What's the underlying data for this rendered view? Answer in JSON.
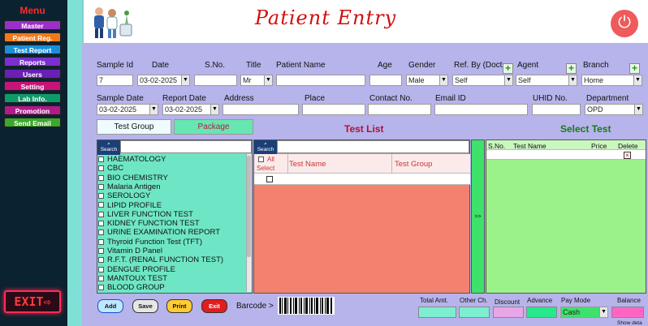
{
  "menu": {
    "title": "Menu",
    "items": [
      {
        "label": "Master",
        "color": "#9b30c8"
      },
      {
        "label": "Patient Reg.",
        "color": "#f07a1a"
      },
      {
        "label": "Test Report",
        "color": "#1a8fd8"
      },
      {
        "label": "Reports",
        "color": "#7a2fd0"
      },
      {
        "label": "Users",
        "color": "#6a1fb5"
      },
      {
        "label": "Setting",
        "color": "#c8147a"
      },
      {
        "label": "Lab Info.",
        "color": "#0f9a6a"
      },
      {
        "label": "Promotion",
        "color": "#b01a8a"
      },
      {
        "label": "Send Email",
        "color": "#3aa82a"
      }
    ],
    "exit_label": "EXIT⇨"
  },
  "header": {
    "title": "Patient Entry"
  },
  "form": {
    "row1_labels": {
      "sample_id": "Sample Id",
      "date": "Date",
      "sno": "S.No.",
      "title": "Title",
      "patient_name": "Patient Name",
      "age": "Age",
      "gender": "Gender",
      "ref_by": "Ref. By (Doct",
      "agent": "Agent",
      "branch": "Branch"
    },
    "row1_values": {
      "sample_id": "7",
      "date": "03-02-2025",
      "sno": "",
      "title": "Mr",
      "patient_name": "",
      "age": "",
      "gender": "Male",
      "ref_by": "Self",
      "agent": "Self",
      "branch": "Home"
    },
    "row2_labels": {
      "sample_date": "Sample Date",
      "report_date": "Report Date",
      "address": "Address",
      "place": "Place",
      "contact": "Contact No.",
      "email": "Email ID",
      "uhid": "UHID No.",
      "department": "Department"
    },
    "row2_values": {
      "sample_date": "03-02-2025",
      "report_date": "03-02-2025",
      "address": "",
      "place": "",
      "contact": "",
      "email": "",
      "uhid": "",
      "department": "OPD"
    }
  },
  "tabs": {
    "test_group": "Test Group",
    "package": "Package"
  },
  "test_list": {
    "title": "Test List",
    "search_label": "Search",
    "col_all": "All",
    "col_select": "Select",
    "col_test_name": "Test Name",
    "col_test_group": "Test Group",
    "arrow": ">>"
  },
  "group_list": {
    "search_label": "Search",
    "items": [
      "HAEMATOLOGY",
      "CBC",
      "BIO CHEMISTRY",
      "Malaria Antigen",
      "SEROLOGY",
      "LIPID PROFILE",
      "LIVER FUNCTION TEST",
      "KIDNEY FUNCTION TEST",
      "URINE EXAMINATION REPORT",
      "Thyroid Function Test (TFT)",
      "Vitamin D Panel",
      "R.F.T. (RENAL FUNCTION TEST)",
      "DENGUE PROFILE",
      "MANTOUX TEST",
      "BLOOD GROUP"
    ]
  },
  "select_test": {
    "title": "Select Test",
    "col_sno": "S.No.",
    "col_test_name": "Test Name",
    "col_price": "Price",
    "col_delete": "Delete",
    "delete_icon": "×"
  },
  "footer": {
    "add": "Add",
    "save": "Save",
    "print": "Print",
    "exit": "Exit",
    "barcode_label": "Barcode >",
    "total_amt": "Total Amt.",
    "other_ch": "Other Ch.",
    "discount": "Discount",
    "advance": "Advance",
    "pay_mode": "Pay Mode",
    "pay_mode_value": "Cash",
    "balance": "Balance",
    "show_details": "Show deta"
  }
}
